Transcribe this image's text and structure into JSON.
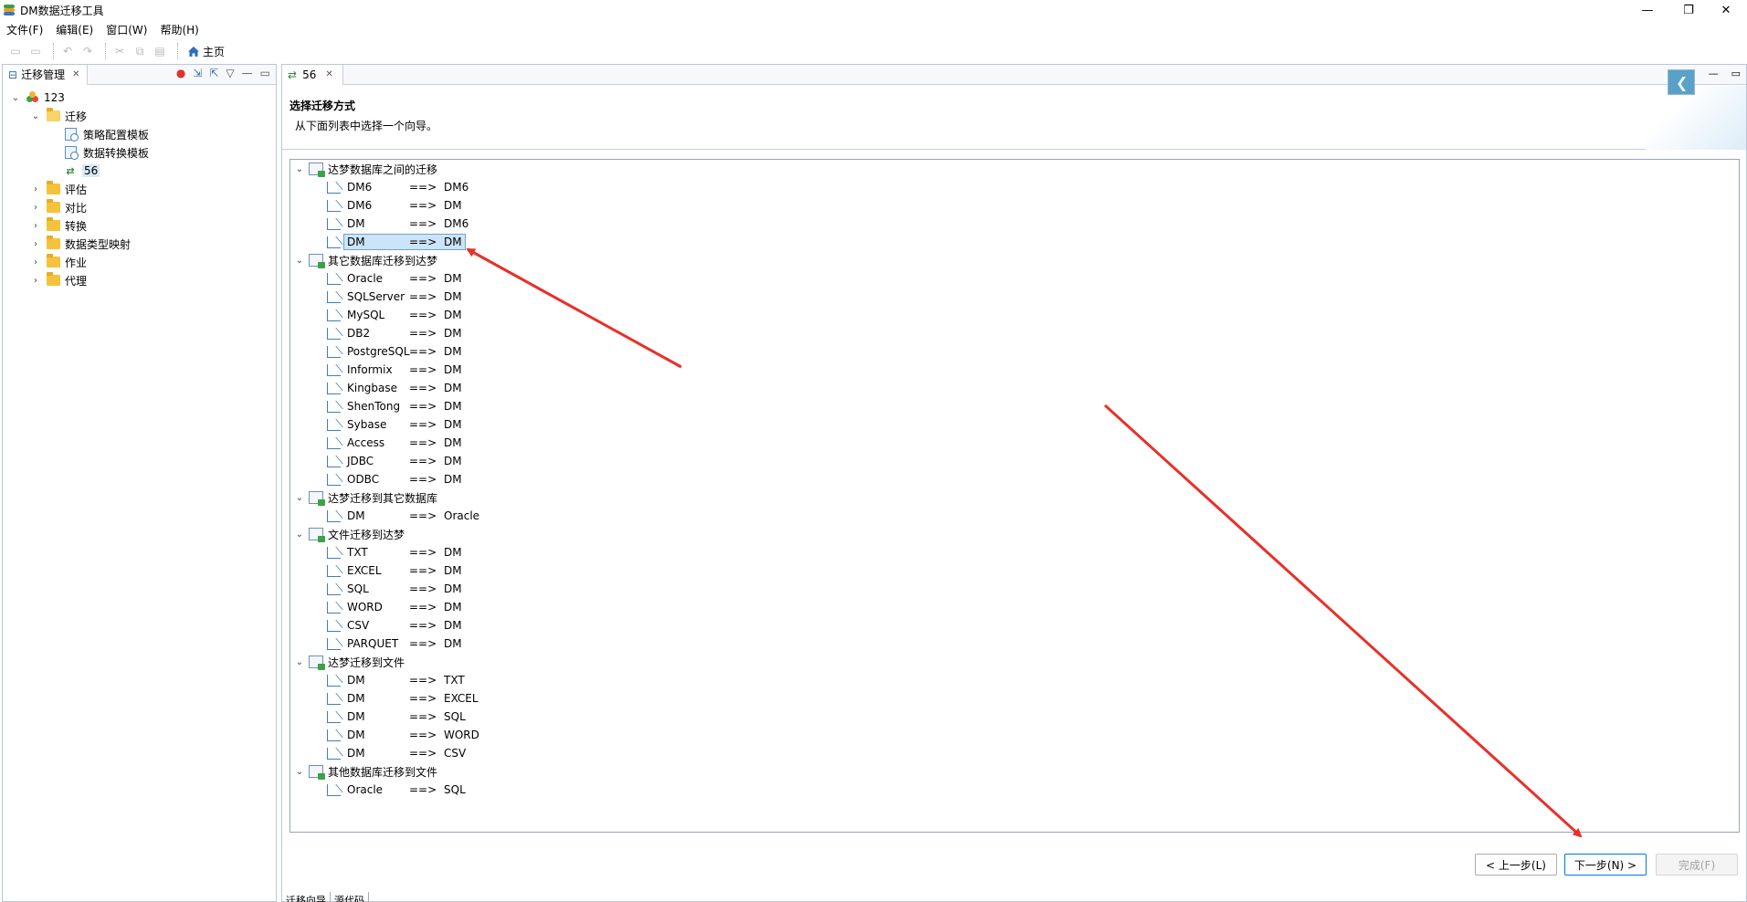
{
  "window": {
    "title": "DM数据迁移工具",
    "minimize_icon": "—",
    "maximize_icon": "❐",
    "close_icon": "✕"
  },
  "menu": [
    "文件(F)",
    "编辑(E)",
    "窗口(W)",
    "帮助(H)"
  ],
  "toolbar": {
    "home_label": "主页"
  },
  "left_panel": {
    "tab_label": "迁移管理",
    "tree": [
      {
        "label": "123",
        "level": 0,
        "icon": "database-icon",
        "expanded": true
      },
      {
        "label": "迁移",
        "level": 1,
        "icon": "folder-open-icon",
        "expanded": true
      },
      {
        "label": "策略配置模板",
        "level": 2,
        "icon": "template-icon"
      },
      {
        "label": "数据转换模板",
        "level": 2,
        "icon": "template-icon"
      },
      {
        "label": "56",
        "level": 2,
        "icon": "migration-icon",
        "selected": true
      },
      {
        "label": "评估",
        "level": 1,
        "icon": "folder-icon"
      },
      {
        "label": "对比",
        "level": 1,
        "icon": "folder-icon"
      },
      {
        "label": "转换",
        "level": 1,
        "icon": "folder-icon"
      },
      {
        "label": "数据类型映射",
        "level": 1,
        "icon": "folder-icon"
      },
      {
        "label": "作业",
        "level": 1,
        "icon": "folder-icon"
      },
      {
        "label": "代理",
        "level": 1,
        "icon": "folder-icon"
      }
    ]
  },
  "editor": {
    "tab_label": "56",
    "wizard_title": "选择迁移方式",
    "wizard_desc": "从下面列表中选择一个向导。",
    "groups": [
      {
        "label": "达梦数据库之间的迁移",
        "items": [
          {
            "src": "DM6",
            "arrow": "==>",
            "dst": "DM6"
          },
          {
            "src": "DM6",
            "arrow": "==>",
            "dst": "DM"
          },
          {
            "src": "DM",
            "arrow": "==>",
            "dst": "DM6"
          },
          {
            "src": "DM",
            "arrow": "==>",
            "dst": "DM",
            "selected": true
          }
        ]
      },
      {
        "label": "其它数据库迁移到达梦",
        "items": [
          {
            "src": "Oracle",
            "arrow": "==>",
            "dst": "DM"
          },
          {
            "src": "SQLServer",
            "arrow": "==>",
            "dst": "DM"
          },
          {
            "src": "MySQL",
            "arrow": "==>",
            "dst": "DM"
          },
          {
            "src": "DB2",
            "arrow": "==>",
            "dst": "DM"
          },
          {
            "src": "PostgreSQL",
            "arrow": "==>",
            "dst": "DM"
          },
          {
            "src": "Informix",
            "arrow": "==>",
            "dst": "DM"
          },
          {
            "src": "Kingbase",
            "arrow": "==>",
            "dst": "DM"
          },
          {
            "src": "ShenTong",
            "arrow": "==>",
            "dst": "DM"
          },
          {
            "src": "Sybase",
            "arrow": "==>",
            "dst": "DM"
          },
          {
            "src": "Access",
            "arrow": "==>",
            "dst": "DM"
          },
          {
            "src": "JDBC",
            "arrow": "==>",
            "dst": "DM"
          },
          {
            "src": "ODBC",
            "arrow": "==>",
            "dst": "DM"
          }
        ]
      },
      {
        "label": "达梦迁移到其它数据库",
        "items": [
          {
            "src": "DM",
            "arrow": "==>",
            "dst": "Oracle"
          }
        ]
      },
      {
        "label": "文件迁移到达梦",
        "items": [
          {
            "src": "TXT",
            "arrow": "==>",
            "dst": "DM"
          },
          {
            "src": "EXCEL",
            "arrow": "==>",
            "dst": "DM"
          },
          {
            "src": "SQL",
            "arrow": "==>",
            "dst": "DM"
          },
          {
            "src": "WORD",
            "arrow": "==>",
            "dst": "DM"
          },
          {
            "src": "CSV",
            "arrow": "==>",
            "dst": "DM"
          },
          {
            "src": "PARQUET",
            "arrow": "==>",
            "dst": "DM"
          }
        ]
      },
      {
        "label": "达梦迁移到文件",
        "items": [
          {
            "src": "DM",
            "arrow": "==>",
            "dst": "TXT"
          },
          {
            "src": "DM",
            "arrow": "==>",
            "dst": "EXCEL"
          },
          {
            "src": "DM",
            "arrow": "==>",
            "dst": "SQL"
          },
          {
            "src": "DM",
            "arrow": "==>",
            "dst": "WORD"
          },
          {
            "src": "DM",
            "arrow": "==>",
            "dst": "CSV"
          }
        ]
      },
      {
        "label": "其他数据库迁移到文件",
        "items": [
          {
            "src": "Oracle",
            "arrow": "==>",
            "dst": "SQL"
          }
        ]
      }
    ],
    "buttons": {
      "back": "< 上一步(L)",
      "next": "下一步(N) >",
      "finish": "完成(F)"
    },
    "bottom_tabs": [
      "迁移向导",
      "源代码"
    ]
  },
  "colors": {
    "annotation_arrow": "#e8302a",
    "selection": "#cce4f7",
    "accent": "#0078d7"
  }
}
